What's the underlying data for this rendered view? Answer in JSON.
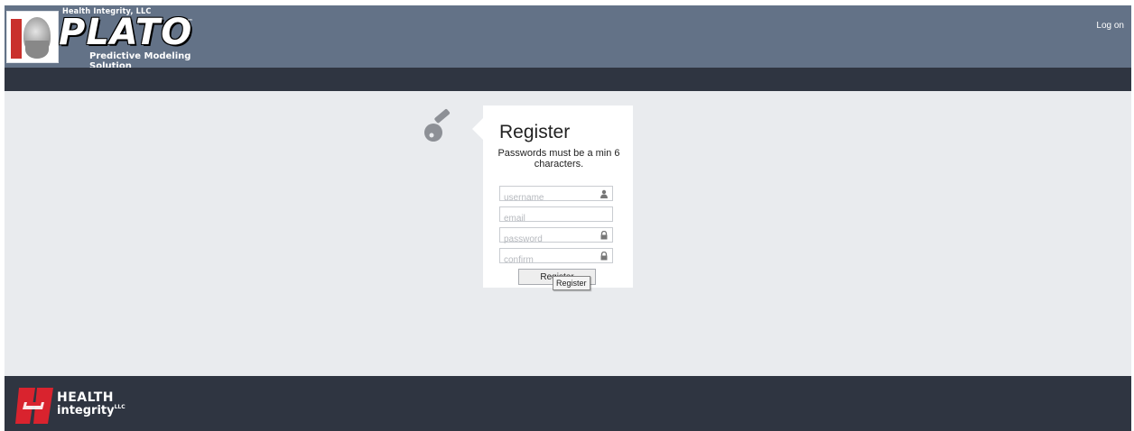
{
  "header": {
    "company_small": "Health Integrity, LLC",
    "product_name": "PLATO",
    "trademark": "™",
    "tagline": "Predictive Modeling Solution",
    "login_link": "Log on",
    "background_color": "#637287"
  },
  "navbar": {
    "background_color": "#2f3541"
  },
  "register": {
    "title": "Register",
    "subtitle": "Passwords must be a min 6 characters.",
    "fields": {
      "username": {
        "placeholder": "username",
        "value": "",
        "icon": "user-icon"
      },
      "email": {
        "placeholder": "email",
        "value": ""
      },
      "password": {
        "placeholder": "password",
        "value": "",
        "icon": "lock-icon"
      },
      "confirm": {
        "placeholder": "confirm",
        "value": "",
        "icon": "lock-icon"
      }
    },
    "submit_label": "Register",
    "tooltip": "Register",
    "decor_icon": "key-icon"
  },
  "footer": {
    "brand_line1": "HEALTH",
    "brand_line2": "integrity",
    "brand_suffix": "LLC",
    "accent_color": "#d9232e",
    "background_color": "#2f3541"
  }
}
